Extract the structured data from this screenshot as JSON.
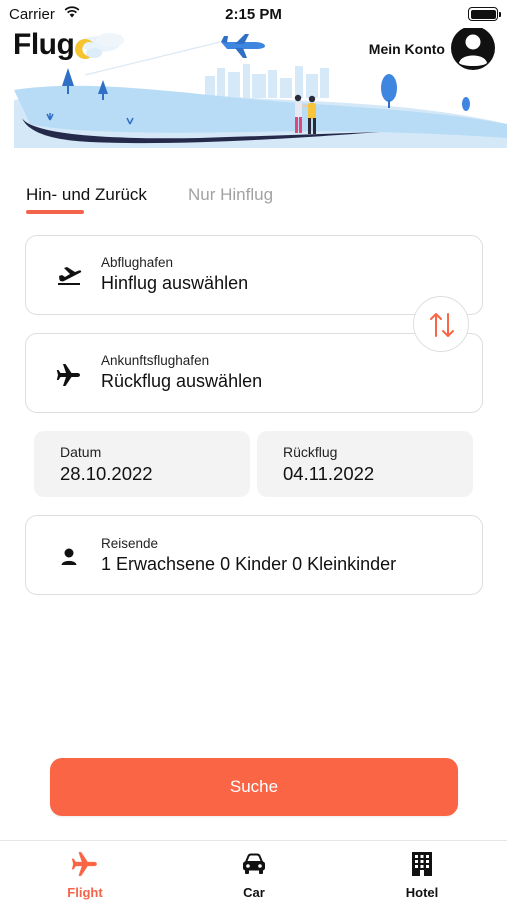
{
  "status_bar": {
    "carrier": "Carrier",
    "time": "2:15 PM"
  },
  "header": {
    "logo_text": "Flug",
    "account_label": "Mein Konto",
    "avatar_icon": "person-circle-icon"
  },
  "tabs": [
    {
      "label": "Hin- und Zurück",
      "active": true
    },
    {
      "label": "Nur Hinflug",
      "active": false
    }
  ],
  "origin": {
    "icon": "plane-takeoff-icon",
    "label": "Abflughafen",
    "value": "Hinflug auswählen"
  },
  "destination": {
    "icon": "plane-icon",
    "label": "Ankunftsflughafen",
    "value": "Rückflug auswählen"
  },
  "swap": {
    "icon": "swap-arrows-icon"
  },
  "dates": {
    "depart": {
      "label": "Datum",
      "value": "28.10.2022"
    },
    "return": {
      "label": "Rückflug",
      "value": "04.11.2022"
    }
  },
  "travelers": {
    "icon": "person-icon",
    "label": "Reisende",
    "value": "1 Erwachsene 0 Kinder 0 Kleinkinder"
  },
  "search": {
    "label": "Suche"
  },
  "bottom_nav": [
    {
      "label": "Flight",
      "icon": "plane-icon",
      "active": true
    },
    {
      "label": "Car",
      "icon": "car-icon",
      "active": false
    },
    {
      "label": "Hotel",
      "icon": "building-icon",
      "active": false
    }
  ],
  "colors": {
    "accent": "#fa6546",
    "inactive_tab": "#a2a2a2",
    "card_border": "#dedede",
    "date_bg": "#f3f3f3",
    "sky_blue": "#b9dcf6"
  }
}
